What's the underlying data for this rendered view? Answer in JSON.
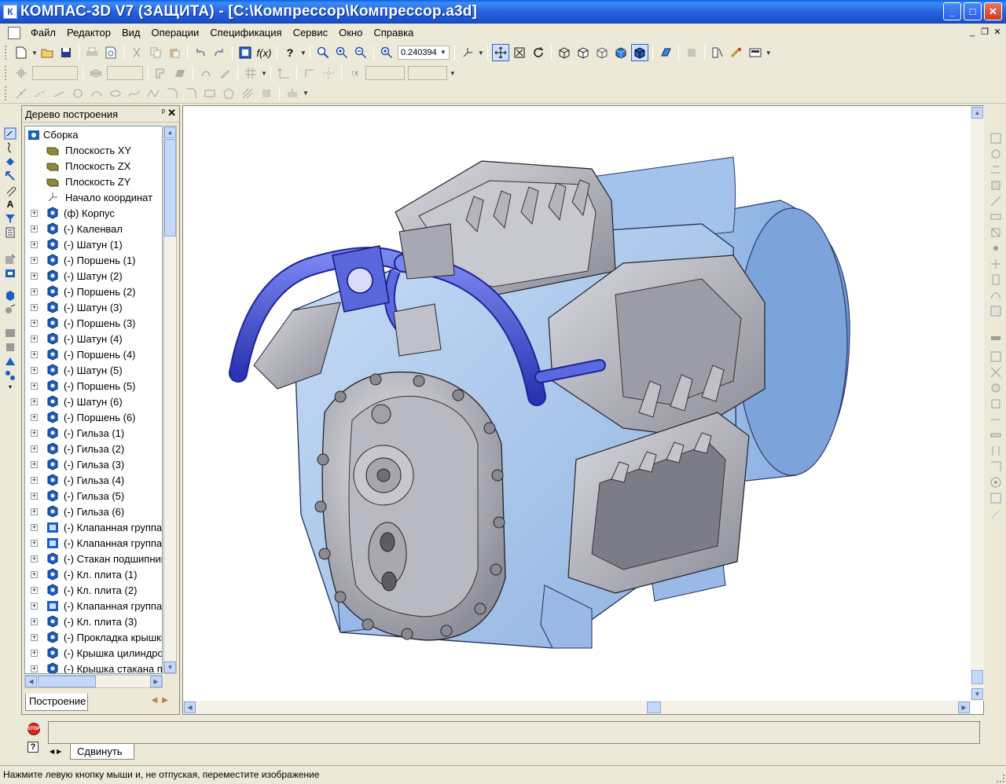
{
  "window": {
    "title": "КОМПАС-3D V7 (ЗАЩИТА) - [C:\\Компрессор\\Компрессор.a3d]",
    "minimize": "_",
    "maximize": "□",
    "close": "✕"
  },
  "menu": [
    "Файл",
    "Редактор",
    "Вид",
    "Операции",
    "Спецификация",
    "Сервис",
    "Окно",
    "Справка"
  ],
  "toolbar": {
    "zoom_value": "0.240394"
  },
  "tree_panel": {
    "title": "Дерево построения",
    "pin": "ᵖ",
    "close": "✕",
    "tab": "Построение",
    "items": [
      {
        "label": "Сборка",
        "kind": "root"
      },
      {
        "label": "Плоскость XY",
        "kind": "plane"
      },
      {
        "label": "Плоскость ZX",
        "kind": "plane"
      },
      {
        "label": "Плоскость ZY",
        "kind": "plane"
      },
      {
        "label": "Начало координат",
        "kind": "origin"
      },
      {
        "label": "(ф) Корпус",
        "kind": "part"
      },
      {
        "label": "(-) Каленвал",
        "kind": "part"
      },
      {
        "label": "(-) Шатун (1)",
        "kind": "part"
      },
      {
        "label": "(-) Поршень (1)",
        "kind": "part"
      },
      {
        "label": "(-) Шатун (2)",
        "kind": "part"
      },
      {
        "label": "(-) Поршень (2)",
        "kind": "part"
      },
      {
        "label": "(-) Шатун (3)",
        "kind": "part"
      },
      {
        "label": "(-) Поршень (3)",
        "kind": "part"
      },
      {
        "label": "(-) Шатун (4)",
        "kind": "part"
      },
      {
        "label": "(-) Поршень (4)",
        "kind": "part"
      },
      {
        "label": "(-) Шатун (5)",
        "kind": "part"
      },
      {
        "label": "(-) Поршень (5)",
        "kind": "part"
      },
      {
        "label": "(-) Шатун (6)",
        "kind": "part"
      },
      {
        "label": "(-) Поршень (6)",
        "kind": "part"
      },
      {
        "label": "(-) Гильза (1)",
        "kind": "part"
      },
      {
        "label": "(-) Гильза (2)",
        "kind": "part"
      },
      {
        "label": "(-) Гильза (3)",
        "kind": "part"
      },
      {
        "label": "(-) Гильза (4)",
        "kind": "part"
      },
      {
        "label": "(-) Гильза (5)",
        "kind": "part"
      },
      {
        "label": "(-) Гильза (6)",
        "kind": "part"
      },
      {
        "label": "(-) Клапанная группа",
        "kind": "asm"
      },
      {
        "label": "(-) Клапанная группа",
        "kind": "asm"
      },
      {
        "label": "(-) Стакан подшипника",
        "kind": "part"
      },
      {
        "label": "(-) Кл. плита (1)",
        "kind": "part"
      },
      {
        "label": "(-) Кл. плита (2)",
        "kind": "part"
      },
      {
        "label": "(-) Клапанная группа",
        "kind": "asm"
      },
      {
        "label": "(-) Кл. плита (3)",
        "kind": "part"
      },
      {
        "label": "(-) Прокладка крышки",
        "kind": "part"
      },
      {
        "label": "(-) Крышка цилиндров",
        "kind": "part"
      },
      {
        "label": "(-) Крышка стакана подшипника",
        "kind": "part"
      }
    ]
  },
  "command_panel": {
    "stop_label": "STOP",
    "help_label": "?",
    "tab": "Сдвинуть"
  },
  "status": {
    "text": "Нажмите левую кнопку мыши и, не отпуская, переместите изображение"
  },
  "colors": {
    "accent": "#1d53cf",
    "model_body": "#a9c8ef",
    "model_grey": "#b9b9c2",
    "pipe": "#4a56d8"
  }
}
